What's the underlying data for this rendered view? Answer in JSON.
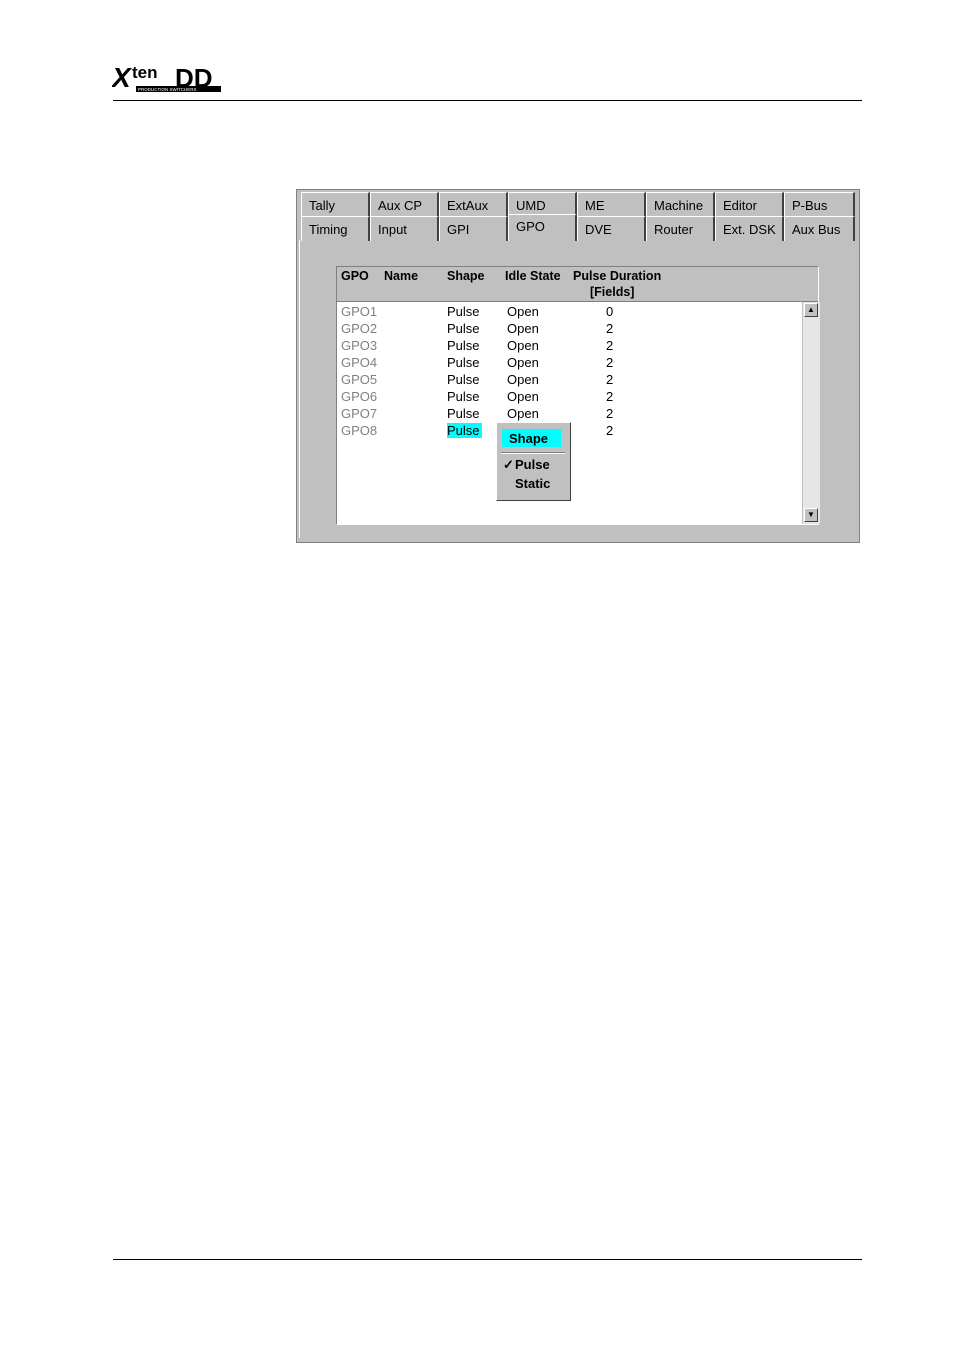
{
  "header": {
    "logo_text": "Xten DD",
    "logo_subtext": "PRODUCTION SWITCHERS"
  },
  "tabs": {
    "row1": [
      "Tally",
      "Aux CP",
      "ExtAux",
      "UMD",
      "ME",
      "Machine",
      "Editor",
      "P-Bus"
    ],
    "row2": [
      "Timing",
      "Input",
      "GPI",
      "GPO",
      "DVE",
      "Router",
      "Ext. DSK",
      "Aux Bus"
    ],
    "active": "GPO"
  },
  "table": {
    "headers": {
      "gpo": "GPO",
      "name": "Name",
      "shape": "Shape",
      "idle_state": "Idle State",
      "pulse_duration": "Pulse Duration",
      "pulse_duration_unit": "[Fields]"
    },
    "rows": [
      {
        "gpo": "GPO1",
        "name": "",
        "shape": "Pulse",
        "idle_state": "Open",
        "pulse_duration": "0"
      },
      {
        "gpo": "GPO2",
        "name": "",
        "shape": "Pulse",
        "idle_state": "Open",
        "pulse_duration": "2"
      },
      {
        "gpo": "GPO3",
        "name": "",
        "shape": "Pulse",
        "idle_state": "Open",
        "pulse_duration": "2"
      },
      {
        "gpo": "GPO4",
        "name": "",
        "shape": "Pulse",
        "idle_state": "Open",
        "pulse_duration": "2"
      },
      {
        "gpo": "GPO5",
        "name": "",
        "shape": "Pulse",
        "idle_state": "Open",
        "pulse_duration": "2"
      },
      {
        "gpo": "GPO6",
        "name": "",
        "shape": "Pulse",
        "idle_state": "Open",
        "pulse_duration": "2"
      },
      {
        "gpo": "GPO7",
        "name": "",
        "shape": "Pulse",
        "idle_state": "Open",
        "pulse_duration": "2"
      },
      {
        "gpo": "GPO8",
        "name": "",
        "shape": "Pulse",
        "idle_state": "",
        "pulse_duration": "2"
      }
    ],
    "selected_row": 7
  },
  "context_menu": {
    "title": "Shape",
    "items": [
      {
        "label": "Pulse",
        "checked": true,
        "check_glyph": "✓"
      },
      {
        "label": "Static",
        "checked": false,
        "check_glyph": ""
      }
    ]
  },
  "colors": {
    "panel": "#c0c0c0",
    "highlight": "#00ffff",
    "gpo_text": "#808080"
  }
}
